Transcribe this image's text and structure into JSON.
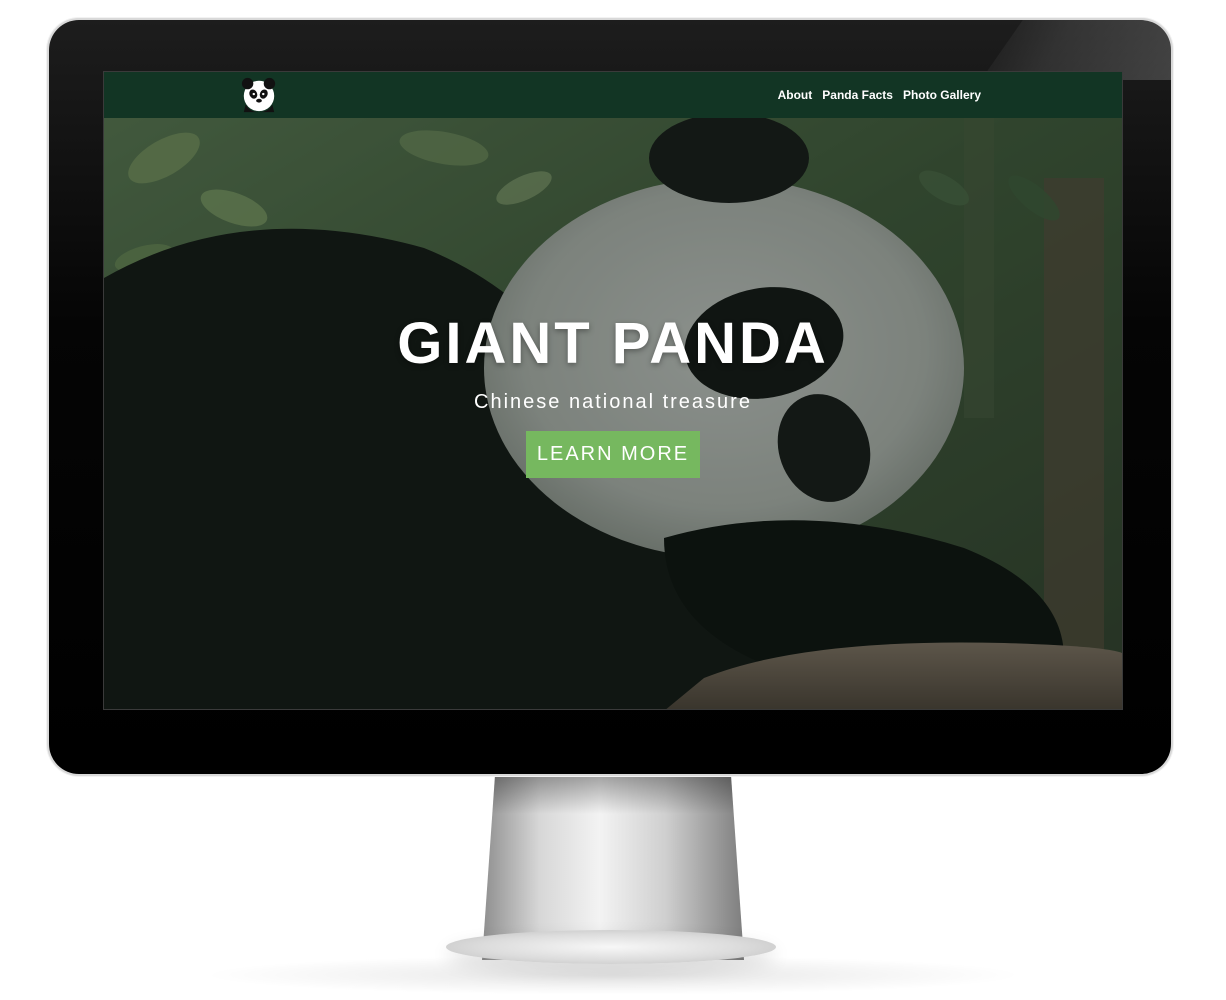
{
  "nav": {
    "logo_icon": "panda-logo-icon",
    "links": [
      {
        "label": "About"
      },
      {
        "label": "Panda Facts"
      },
      {
        "label": "Photo Gallery"
      }
    ]
  },
  "hero": {
    "title": "GIANT PANDA",
    "subtitle": "Chinese national treasure",
    "button_label": "LEARN MORE",
    "background_image": "resting-giant-panda-photo"
  },
  "colors": {
    "navbar": "#123524",
    "button": "#76b85f",
    "text": "#ffffff"
  }
}
